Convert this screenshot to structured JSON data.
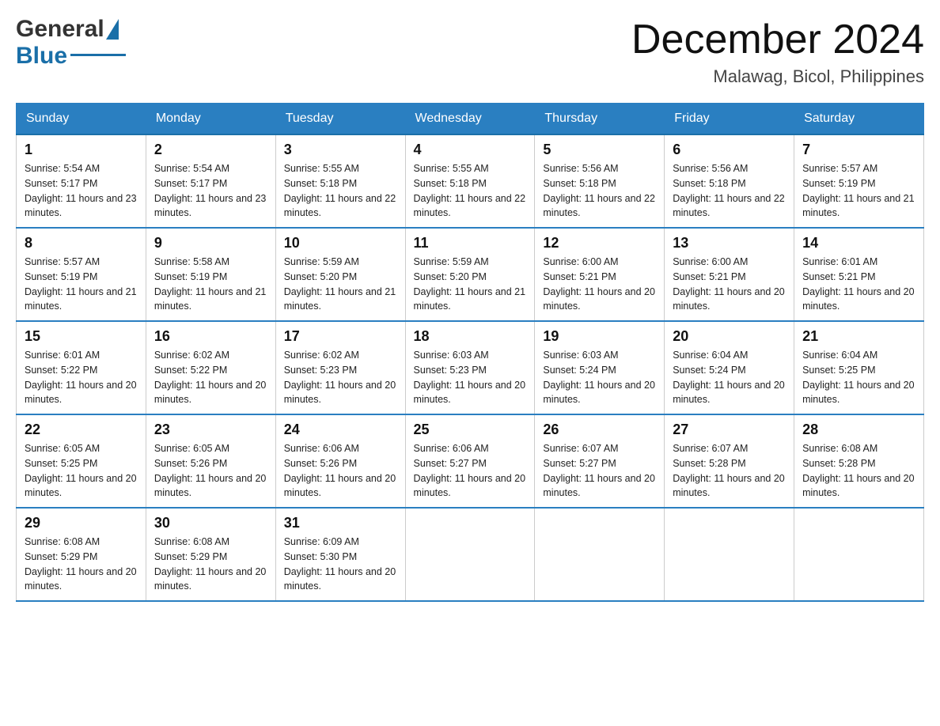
{
  "logo": {
    "general": "General",
    "blue": "Blue"
  },
  "header": {
    "month": "December 2024",
    "location": "Malawag, Bicol, Philippines"
  },
  "days_of_week": [
    "Sunday",
    "Monday",
    "Tuesday",
    "Wednesday",
    "Thursday",
    "Friday",
    "Saturday"
  ],
  "weeks": [
    [
      {
        "day": "1",
        "sunrise": "5:54 AM",
        "sunset": "5:17 PM",
        "daylight": "11 hours and 23 minutes."
      },
      {
        "day": "2",
        "sunrise": "5:54 AM",
        "sunset": "5:17 PM",
        "daylight": "11 hours and 23 minutes."
      },
      {
        "day": "3",
        "sunrise": "5:55 AM",
        "sunset": "5:18 PM",
        "daylight": "11 hours and 22 minutes."
      },
      {
        "day": "4",
        "sunrise": "5:55 AM",
        "sunset": "5:18 PM",
        "daylight": "11 hours and 22 minutes."
      },
      {
        "day": "5",
        "sunrise": "5:56 AM",
        "sunset": "5:18 PM",
        "daylight": "11 hours and 22 minutes."
      },
      {
        "day": "6",
        "sunrise": "5:56 AM",
        "sunset": "5:18 PM",
        "daylight": "11 hours and 22 minutes."
      },
      {
        "day": "7",
        "sunrise": "5:57 AM",
        "sunset": "5:19 PM",
        "daylight": "11 hours and 21 minutes."
      }
    ],
    [
      {
        "day": "8",
        "sunrise": "5:57 AM",
        "sunset": "5:19 PM",
        "daylight": "11 hours and 21 minutes."
      },
      {
        "day": "9",
        "sunrise": "5:58 AM",
        "sunset": "5:19 PM",
        "daylight": "11 hours and 21 minutes."
      },
      {
        "day": "10",
        "sunrise": "5:59 AM",
        "sunset": "5:20 PM",
        "daylight": "11 hours and 21 minutes."
      },
      {
        "day": "11",
        "sunrise": "5:59 AM",
        "sunset": "5:20 PM",
        "daylight": "11 hours and 21 minutes."
      },
      {
        "day": "12",
        "sunrise": "6:00 AM",
        "sunset": "5:21 PM",
        "daylight": "11 hours and 20 minutes."
      },
      {
        "day": "13",
        "sunrise": "6:00 AM",
        "sunset": "5:21 PM",
        "daylight": "11 hours and 20 minutes."
      },
      {
        "day": "14",
        "sunrise": "6:01 AM",
        "sunset": "5:21 PM",
        "daylight": "11 hours and 20 minutes."
      }
    ],
    [
      {
        "day": "15",
        "sunrise": "6:01 AM",
        "sunset": "5:22 PM",
        "daylight": "11 hours and 20 minutes."
      },
      {
        "day": "16",
        "sunrise": "6:02 AM",
        "sunset": "5:22 PM",
        "daylight": "11 hours and 20 minutes."
      },
      {
        "day": "17",
        "sunrise": "6:02 AM",
        "sunset": "5:23 PM",
        "daylight": "11 hours and 20 minutes."
      },
      {
        "day": "18",
        "sunrise": "6:03 AM",
        "sunset": "5:23 PM",
        "daylight": "11 hours and 20 minutes."
      },
      {
        "day": "19",
        "sunrise": "6:03 AM",
        "sunset": "5:24 PM",
        "daylight": "11 hours and 20 minutes."
      },
      {
        "day": "20",
        "sunrise": "6:04 AM",
        "sunset": "5:24 PM",
        "daylight": "11 hours and 20 minutes."
      },
      {
        "day": "21",
        "sunrise": "6:04 AM",
        "sunset": "5:25 PM",
        "daylight": "11 hours and 20 minutes."
      }
    ],
    [
      {
        "day": "22",
        "sunrise": "6:05 AM",
        "sunset": "5:25 PM",
        "daylight": "11 hours and 20 minutes."
      },
      {
        "day": "23",
        "sunrise": "6:05 AM",
        "sunset": "5:26 PM",
        "daylight": "11 hours and 20 minutes."
      },
      {
        "day": "24",
        "sunrise": "6:06 AM",
        "sunset": "5:26 PM",
        "daylight": "11 hours and 20 minutes."
      },
      {
        "day": "25",
        "sunrise": "6:06 AM",
        "sunset": "5:27 PM",
        "daylight": "11 hours and 20 minutes."
      },
      {
        "day": "26",
        "sunrise": "6:07 AM",
        "sunset": "5:27 PM",
        "daylight": "11 hours and 20 minutes."
      },
      {
        "day": "27",
        "sunrise": "6:07 AM",
        "sunset": "5:28 PM",
        "daylight": "11 hours and 20 minutes."
      },
      {
        "day": "28",
        "sunrise": "6:08 AM",
        "sunset": "5:28 PM",
        "daylight": "11 hours and 20 minutes."
      }
    ],
    [
      {
        "day": "29",
        "sunrise": "6:08 AM",
        "sunset": "5:29 PM",
        "daylight": "11 hours and 20 minutes."
      },
      {
        "day": "30",
        "sunrise": "6:08 AM",
        "sunset": "5:29 PM",
        "daylight": "11 hours and 20 minutes."
      },
      {
        "day": "31",
        "sunrise": "6:09 AM",
        "sunset": "5:30 PM",
        "daylight": "11 hours and 20 minutes."
      },
      null,
      null,
      null,
      null
    ]
  ]
}
